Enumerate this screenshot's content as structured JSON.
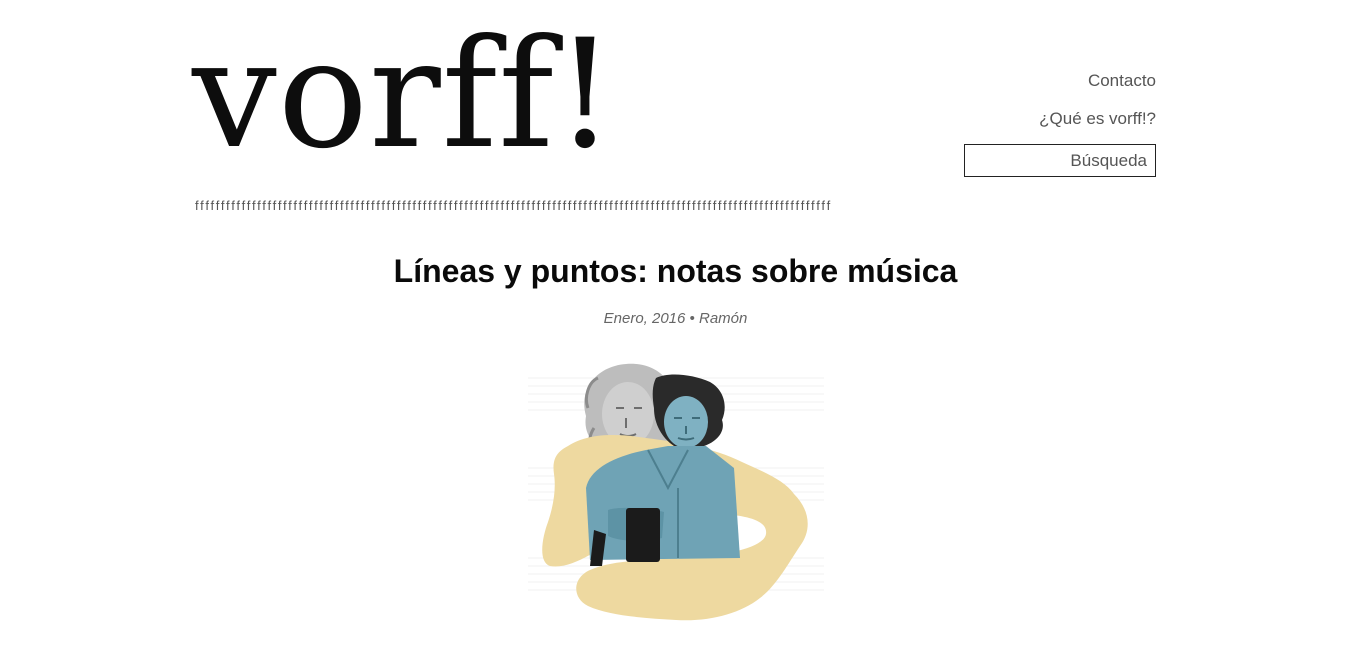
{
  "site": {
    "logo": "vorff!",
    "divider": "fffffffffffffffffffffffffffffffffffffffffffffffffffffffffffffffffffffffffffffffffffffffffffffffffffffffffffffffffffffffffff"
  },
  "nav": {
    "contacto": "Contacto",
    "que_es": "¿Qué es vorff!?"
  },
  "search": {
    "placeholder": "Búsqueda"
  },
  "post": {
    "title": "Líneas y puntos: notas sobre música",
    "date": "Enero, 2016",
    "separator": "•",
    "author": "Ramón"
  },
  "colors": {
    "accent_yellow": "#eed9a0",
    "figure_blue": "#6fa3b5"
  }
}
